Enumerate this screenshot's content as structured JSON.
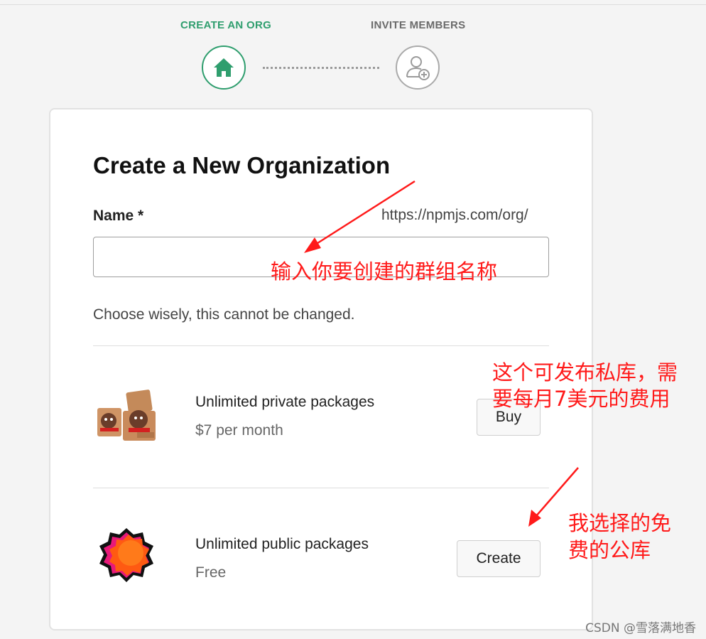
{
  "stepper": {
    "step1_label": "CREATE AN ORG",
    "step2_label": "INVITE MEMBERS",
    "active_color": "#2f9e6e",
    "inactive_color": "#aaaaaa"
  },
  "form": {
    "title": "Create a New Organization",
    "name_label": "Name *",
    "url_prefix": "https://npmjs.com/org/",
    "name_value": "",
    "hint": "Choose wisely, this cannot be changed."
  },
  "plans": [
    {
      "title": "Unlimited private packages",
      "subtitle": "$7 per month",
      "button_label": "Buy",
      "icon": "boxes-mascot-icon"
    },
    {
      "title": "Unlimited public packages",
      "subtitle": "Free",
      "button_label": "Create",
      "icon": "orange-flower-icon"
    }
  ],
  "annotations": {
    "name_note": "输入你要创建的群组名称",
    "private_note_line1": "这个可发布私库，需",
    "private_note_line2": "要每月7美元的费用",
    "public_note_line1": "我选择的免",
    "public_note_line2": "费的公库",
    "color": "#ff1a1a"
  },
  "watermark": "CSDN @雪落满地香"
}
